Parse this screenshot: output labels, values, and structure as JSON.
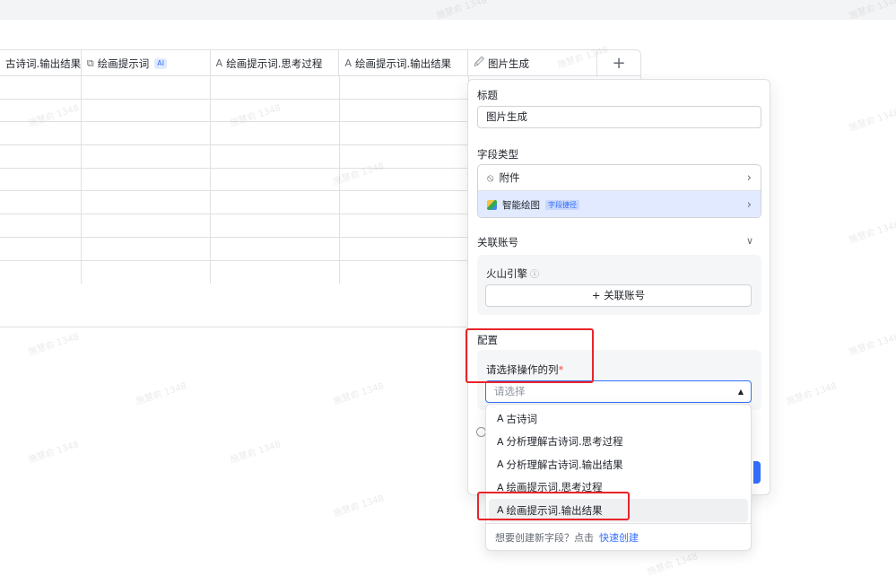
{
  "grid": {
    "columns": [
      {
        "icon": "",
        "label": "古诗词.输出结果"
      },
      {
        "icon": "⧉",
        "label": "绘画提示词",
        "badge": "AI"
      },
      {
        "icon": "A",
        "label": "绘画提示词.思考过程"
      },
      {
        "icon": "A",
        "label": "绘画提示词.输出结果"
      },
      {
        "icon": "🖉",
        "label": "图片生成"
      }
    ],
    "add_column": "+"
  },
  "panel": {
    "title_label": "标题",
    "title_value": "图片生成",
    "field_type_label": "字段类型",
    "type_attachment": "附件",
    "type_ai_paint": "智能绘图",
    "type_ai_badge": "字段捷径",
    "linked_account_label": "关联账号",
    "engine_label": "火山引擎",
    "add_account_button": "+ 关联账号",
    "config_label": "配置",
    "column_select_label": "请选择操作的列",
    "required_mark": "*",
    "select_placeholder": "请选择"
  },
  "dropdown": {
    "options": [
      "古诗词",
      "分析理解古诗词.思考过程",
      "分析理解古诗词.输出结果",
      "绘画提示词.思考过程",
      "绘画提示词.输出结果"
    ],
    "footer_text": "想要创建新字段？点击",
    "footer_link": "快速创建"
  },
  "watermark": "施慧俞 1348",
  "colors": {
    "accent": "#3370ff",
    "annotation": "#e8242b",
    "selected_row": "#e1eaff"
  }
}
